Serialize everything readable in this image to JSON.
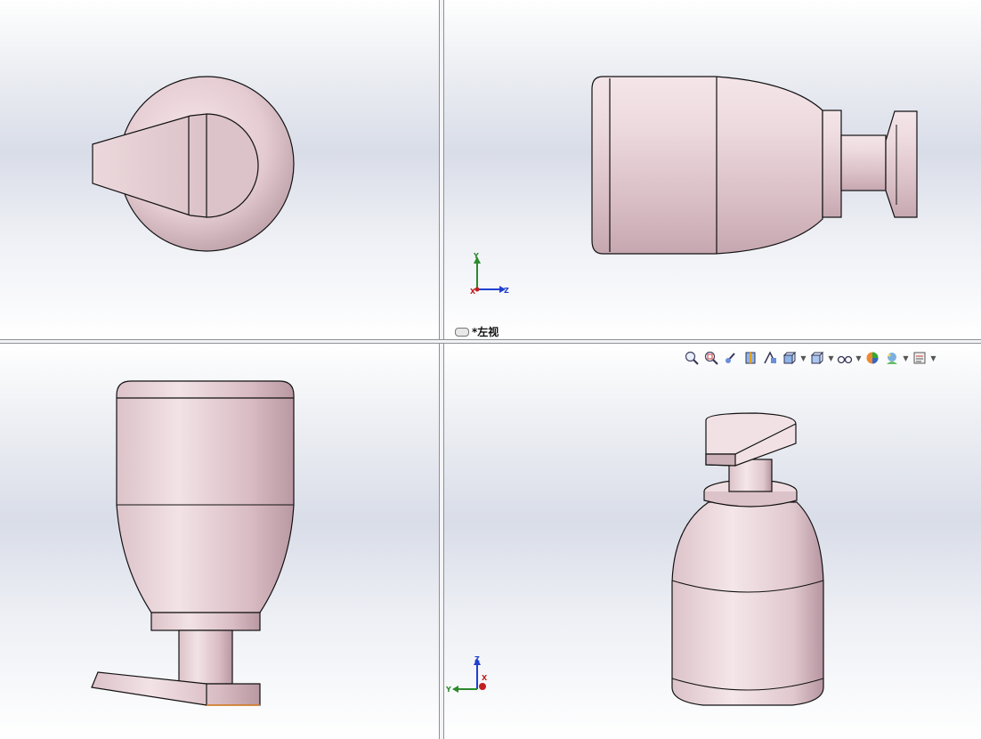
{
  "window": {
    "active_view_label": "*左视",
    "accent_part_color": "#e6cdd2"
  },
  "views": [
    {
      "id": "top-left",
      "kind": "top-view"
    },
    {
      "id": "top-right",
      "kind": "left-view",
      "label": "*左视"
    },
    {
      "id": "bottom-left",
      "kind": "front-view"
    },
    {
      "id": "bottom-right",
      "kind": "isometric-view"
    }
  ],
  "triad_left": {
    "axis1": "Y",
    "axis2": "X",
    "axis3": "Z"
  },
  "triad_iso": {
    "axis1": "Z",
    "axis2": "Y",
    "axis3": "X"
  },
  "heads_up_toolbar": {
    "buttons": [
      {
        "name": "zoom-to-fit-icon"
      },
      {
        "name": "zoom-to-area-icon"
      },
      {
        "name": "previous-view-icon"
      },
      {
        "name": "section-view-icon"
      },
      {
        "name": "dynamic-annotation-icon"
      },
      {
        "name": "view-orientation-icon",
        "dropdown": true
      },
      {
        "name": "display-style-icon",
        "dropdown": true
      },
      {
        "name": "hide-show-items-icon",
        "dropdown": true
      },
      {
        "name": "edit-appearance-icon"
      },
      {
        "name": "apply-scene-icon",
        "dropdown": true
      },
      {
        "name": "view-settings-icon",
        "dropdown": true
      }
    ]
  }
}
